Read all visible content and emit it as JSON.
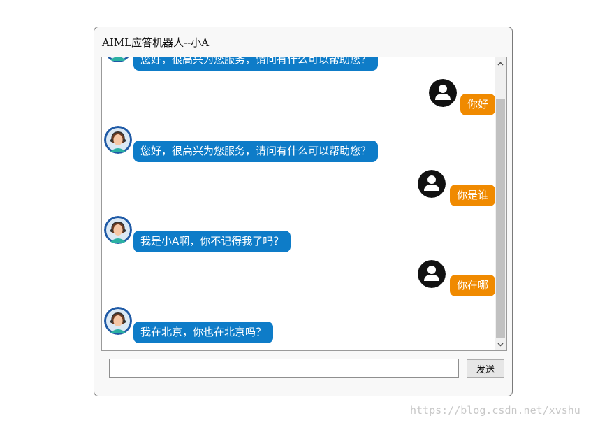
{
  "window": {
    "title": "AIML应答机器人--小A"
  },
  "chat": {
    "messages": [
      {
        "sender": "bot",
        "text": "您好，很高兴为您服务，请问有什么可以帮助您？"
      },
      {
        "sender": "user",
        "text": "你好"
      },
      {
        "sender": "bot",
        "text": "您好，很高兴为您服务，请问有什么可以帮助您？"
      },
      {
        "sender": "user",
        "text": "你是谁"
      },
      {
        "sender": "bot",
        "text": "我是小A啊，你不记得我了吗？"
      },
      {
        "sender": "user",
        "text": "你在哪"
      },
      {
        "sender": "bot",
        "text": "我在北京，你也在北京吗？"
      }
    ]
  },
  "input": {
    "value": ""
  },
  "send_button": {
    "label": "发送"
  },
  "watermark": {
    "text": "https://blog.csdn.net/xvshu"
  },
  "colors": {
    "bot_bubble": "#0e7cc8",
    "user_bubble": "#f08a00"
  },
  "icons": {
    "bot_avatar": "customer-service-agent-icon",
    "user_avatar": "user-silhouette-icon",
    "scroll_up": "arrow-up-icon",
    "scroll_down": "arrow-down-icon"
  }
}
